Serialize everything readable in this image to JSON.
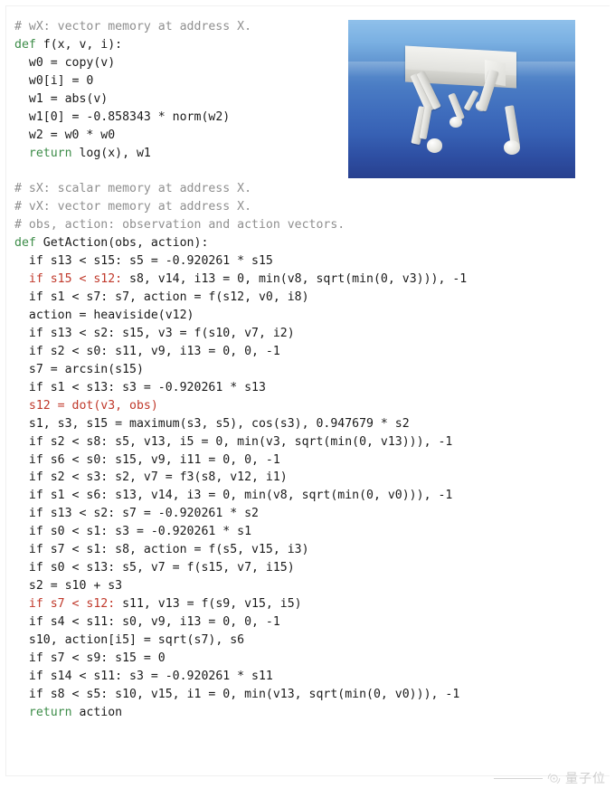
{
  "figure": {
    "kind": "code-listing-with-render",
    "background_color": "#ffffff",
    "colors": {
      "comment": "#8f8f8f",
      "keyword": "#3c8c48",
      "highlight_red": "#c0392b",
      "plain_text": "#1a1a1a",
      "sky_top": "#8fc0ea",
      "sky_bottom": "#28408f",
      "robot_body": "#e9e9e6"
    }
  },
  "code": {
    "language": "python",
    "lines": [
      {
        "id": "l1",
        "indent": 0,
        "segments": [
          {
            "style": "comment",
            "text": "# wX: vector memory at address X."
          }
        ]
      },
      {
        "id": "l2",
        "indent": 0,
        "segments": [
          {
            "style": "keyword",
            "text": "def"
          },
          {
            "style": "plain",
            "text": " f(x, v, i):"
          }
        ]
      },
      {
        "id": "l3",
        "indent": 1,
        "segments": [
          {
            "style": "plain",
            "text": "w0 = copy(v)"
          }
        ]
      },
      {
        "id": "l4",
        "indent": 1,
        "segments": [
          {
            "style": "plain",
            "text": "w0[i] = 0"
          }
        ]
      },
      {
        "id": "l5",
        "indent": 1,
        "segments": [
          {
            "style": "plain",
            "text": "w1 = abs(v)"
          }
        ]
      },
      {
        "id": "l6",
        "indent": 1,
        "segments": [
          {
            "style": "plain",
            "text": "w1[0] = -0.858343 * norm(w2)"
          }
        ]
      },
      {
        "id": "l7",
        "indent": 1,
        "segments": [
          {
            "style": "plain",
            "text": "w2 = w0 * w0"
          }
        ]
      },
      {
        "id": "l8",
        "indent": 1,
        "segments": [
          {
            "style": "keyword",
            "text": "return"
          },
          {
            "style": "plain",
            "text": " log(x), w1"
          }
        ]
      },
      {
        "id": "l9",
        "indent": 0,
        "blank": true,
        "segments": [
          {
            "style": "plain",
            "text": " "
          }
        ]
      },
      {
        "id": "l10",
        "indent": 0,
        "segments": [
          {
            "style": "comment",
            "text": "# sX: scalar memory at address X."
          }
        ]
      },
      {
        "id": "l11",
        "indent": 0,
        "segments": [
          {
            "style": "comment",
            "text": "# vX: vector memory at address X."
          }
        ]
      },
      {
        "id": "l12",
        "indent": 0,
        "segments": [
          {
            "style": "comment",
            "text": "# obs, action: observation and action vectors."
          }
        ]
      },
      {
        "id": "l13",
        "indent": 0,
        "segments": [
          {
            "style": "keyword",
            "text": "def"
          },
          {
            "style": "plain",
            "text": " GetAction(obs, action):"
          }
        ]
      },
      {
        "id": "l14",
        "indent": 1,
        "segments": [
          {
            "style": "plain",
            "text": "if s13 < s15: s5 = -0.920261 * s15"
          }
        ]
      },
      {
        "id": "l15",
        "indent": 1,
        "segments": [
          {
            "style": "red",
            "text": "if s15 < s12:"
          },
          {
            "style": "plain",
            "text": " s8, v14, i13 = 0, min(v8, sqrt(min(0, v3))), -1"
          }
        ]
      },
      {
        "id": "l16",
        "indent": 1,
        "segments": [
          {
            "style": "plain",
            "text": "if s1 < s7: s7, action = f(s12, v0, i8)"
          }
        ]
      },
      {
        "id": "l17",
        "indent": 1,
        "segments": [
          {
            "style": "plain",
            "text": "action = heaviside(v12)"
          }
        ]
      },
      {
        "id": "l18",
        "indent": 1,
        "segments": [
          {
            "style": "plain",
            "text": "if s13 < s2: s15, v3 = f(s10, v7, i2)"
          }
        ]
      },
      {
        "id": "l19",
        "indent": 1,
        "segments": [
          {
            "style": "plain",
            "text": "if s2 < s0: s11, v9, i13 = 0, 0, -1"
          }
        ]
      },
      {
        "id": "l20",
        "indent": 1,
        "segments": [
          {
            "style": "plain",
            "text": "s7 = arcsin(s15)"
          }
        ]
      },
      {
        "id": "l21",
        "indent": 1,
        "segments": [
          {
            "style": "plain",
            "text": "if s1 < s13: s3 = -0.920261 * s13"
          }
        ]
      },
      {
        "id": "l22",
        "indent": 1,
        "segments": [
          {
            "style": "red",
            "text": "s12 = dot(v3, obs)"
          }
        ]
      },
      {
        "id": "l23",
        "indent": 1,
        "segments": [
          {
            "style": "plain",
            "text": "s1, s3, s15 = maximum(s3, s5), cos(s3), 0.947679 * s2"
          }
        ]
      },
      {
        "id": "l24",
        "indent": 1,
        "segments": [
          {
            "style": "plain",
            "text": "if s2 < s8: s5, v13, i5 = 0, min(v3, sqrt(min(0, v13))), -1"
          }
        ]
      },
      {
        "id": "l25",
        "indent": 1,
        "segments": [
          {
            "style": "plain",
            "text": "if s6 < s0: s15, v9, i11 = 0, 0, -1"
          }
        ]
      },
      {
        "id": "l26",
        "indent": 1,
        "segments": [
          {
            "style": "plain",
            "text": "if s2 < s3: s2, v7 = f3(s8, v12, i1)"
          }
        ]
      },
      {
        "id": "l27",
        "indent": 1,
        "segments": [
          {
            "style": "plain",
            "text": "if s1 < s6: s13, v14, i3 = 0, min(v8, sqrt(min(0, v0))), -1"
          }
        ]
      },
      {
        "id": "l28",
        "indent": 1,
        "segments": [
          {
            "style": "plain",
            "text": "if s13 < s2: s7 = -0.920261 * s2"
          }
        ]
      },
      {
        "id": "l29",
        "indent": 1,
        "segments": [
          {
            "style": "plain",
            "text": "if s0 < s1: s3 = -0.920261 * s1"
          }
        ]
      },
      {
        "id": "l30",
        "indent": 1,
        "segments": [
          {
            "style": "plain",
            "text": "if s7 < s1: s8, action = f(s5, v15, i3)"
          }
        ]
      },
      {
        "id": "l31",
        "indent": 1,
        "segments": [
          {
            "style": "plain",
            "text": "if s0 < s13: s5, v7 = f(s15, v7, i15)"
          }
        ]
      },
      {
        "id": "l32",
        "indent": 1,
        "segments": [
          {
            "style": "plain",
            "text": "s2 = s10 + s3"
          }
        ]
      },
      {
        "id": "l33",
        "indent": 1,
        "segments": [
          {
            "style": "red",
            "text": "if s7 < s12:"
          },
          {
            "style": "plain",
            "text": " s11, v13 = f(s9, v15, i5)"
          }
        ]
      },
      {
        "id": "l34",
        "indent": 1,
        "segments": [
          {
            "style": "plain",
            "text": "if s4 < s11: s0, v9, i13 = 0, 0, -1"
          }
        ]
      },
      {
        "id": "l35",
        "indent": 1,
        "segments": [
          {
            "style": "plain",
            "text": "s10, action[i5] = sqrt(s7), s6"
          }
        ]
      },
      {
        "id": "l36",
        "indent": 1,
        "segments": [
          {
            "style": "plain",
            "text": "if s7 < s9: s15 = 0"
          }
        ]
      },
      {
        "id": "l37",
        "indent": 1,
        "segments": [
          {
            "style": "plain",
            "text": "if s14 < s11: s3 = -0.920261 * s11"
          }
        ]
      },
      {
        "id": "l38",
        "indent": 1,
        "segments": [
          {
            "style": "plain",
            "text": "if s8 < s5: s10, v15, i1 = 0, min(v13, sqrt(min(0, v0))), -1"
          }
        ]
      },
      {
        "id": "l39",
        "indent": 1,
        "segments": [
          {
            "style": "keyword",
            "text": "return"
          },
          {
            "style": "plain",
            "text": " action"
          }
        ]
      }
    ]
  },
  "robot_render": {
    "label": "quadruped-simulation-render",
    "description": "Rendered quadruped walker robot over a blue gradient sky background"
  },
  "watermark": {
    "text": "量子位"
  }
}
